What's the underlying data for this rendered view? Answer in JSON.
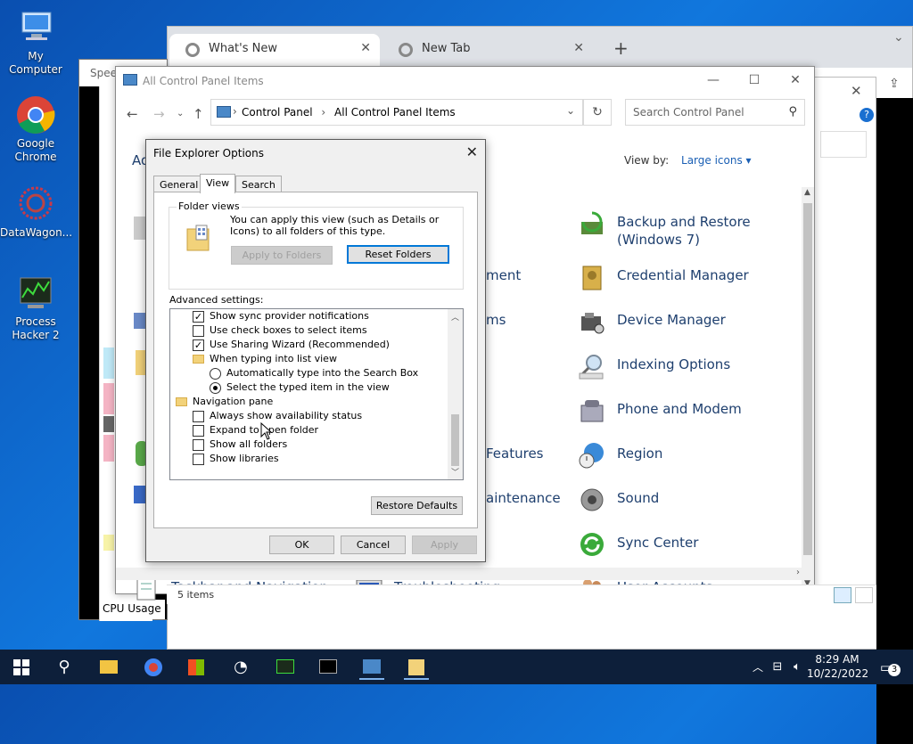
{
  "desktop": {
    "icons": [
      {
        "label": "My Computer"
      },
      {
        "label": "Google Chrome"
      },
      {
        "label": "DataWagon..."
      },
      {
        "label": "Process Hacker 2"
      }
    ]
  },
  "chrome": {
    "tabs": [
      {
        "label": "What's New"
      },
      {
        "label": "New Tab"
      }
    ],
    "new_tab": "+",
    "tab_close": "✕"
  },
  "speed_window": {
    "title": "Speed",
    "cpu_usage": "CPU Usage"
  },
  "control_panel": {
    "title": "All Control Panel Items",
    "breadcrumb": [
      "Control Panel",
      "All Control Panel Items"
    ],
    "search_placeholder": "Search Control Panel",
    "view_by_label": "View by:",
    "view_by_value": "Large icons ▾",
    "adjust_partial": "Ad",
    "status_items": "5 items",
    "items_right": [
      {
        "label": "Backup and Restore (Windows 7)"
      },
      {
        "label": "Credential Manager"
      },
      {
        "label": "Device Manager"
      },
      {
        "label": "Indexing Options"
      },
      {
        "label": "Phone and Modem"
      },
      {
        "label": "Region"
      },
      {
        "label": "Sound"
      },
      {
        "label": "Sync Center"
      },
      {
        "label": "User Accounts"
      }
    ],
    "items_middle_partial": [
      {
        "label": "ment"
      },
      {
        "label": "ms"
      },
      {
        "label": "Features"
      },
      {
        "label": "aintenance"
      }
    ],
    "items_bottom": [
      {
        "label": "Taskbar and Navigation"
      },
      {
        "label": "Troubleshooting"
      }
    ]
  },
  "dialog": {
    "title": "File Explorer Options",
    "tabs": [
      {
        "label": "General"
      },
      {
        "label": "View"
      },
      {
        "label": "Search"
      }
    ],
    "folder_views": {
      "legend": "Folder views",
      "description": "You can apply this view (such as Details or Icons) to all folders of this type.",
      "apply_button": "Apply to Folders",
      "reset_button": "Reset Folders"
    },
    "advanced_label": "Advanced settings:",
    "advanced_rows": [
      {
        "type": "checkbox",
        "checked": true,
        "indent": 1,
        "label": "Show sync provider notifications"
      },
      {
        "type": "checkbox",
        "checked": false,
        "indent": 1,
        "label": "Use check boxes to select items"
      },
      {
        "type": "checkbox",
        "checked": true,
        "indent": 1,
        "label": "Use Sharing Wizard (Recommended)"
      },
      {
        "type": "folder",
        "indent": 1,
        "label": "When typing into list view"
      },
      {
        "type": "radio",
        "checked": false,
        "indent": 2,
        "label": "Automatically type into the Search Box"
      },
      {
        "type": "radio",
        "checked": true,
        "indent": 2,
        "label": "Select the typed item in the view"
      },
      {
        "type": "folder",
        "indent": 0,
        "label": "Navigation pane"
      },
      {
        "type": "checkbox",
        "checked": false,
        "indent": 1,
        "label": "Always show availability status"
      },
      {
        "type": "checkbox",
        "checked": false,
        "indent": 1,
        "label": "Expand to open folder"
      },
      {
        "type": "checkbox",
        "checked": false,
        "indent": 1,
        "label": "Show all folders"
      },
      {
        "type": "checkbox",
        "checked": false,
        "indent": 1,
        "label": "Show libraries"
      }
    ],
    "restore_defaults": "Restore Defaults",
    "ok": "OK",
    "cancel": "Cancel",
    "apply": "Apply"
  },
  "taskbar": {
    "time": "8:29 AM",
    "date": "10/22/2022",
    "notifications": "3"
  }
}
